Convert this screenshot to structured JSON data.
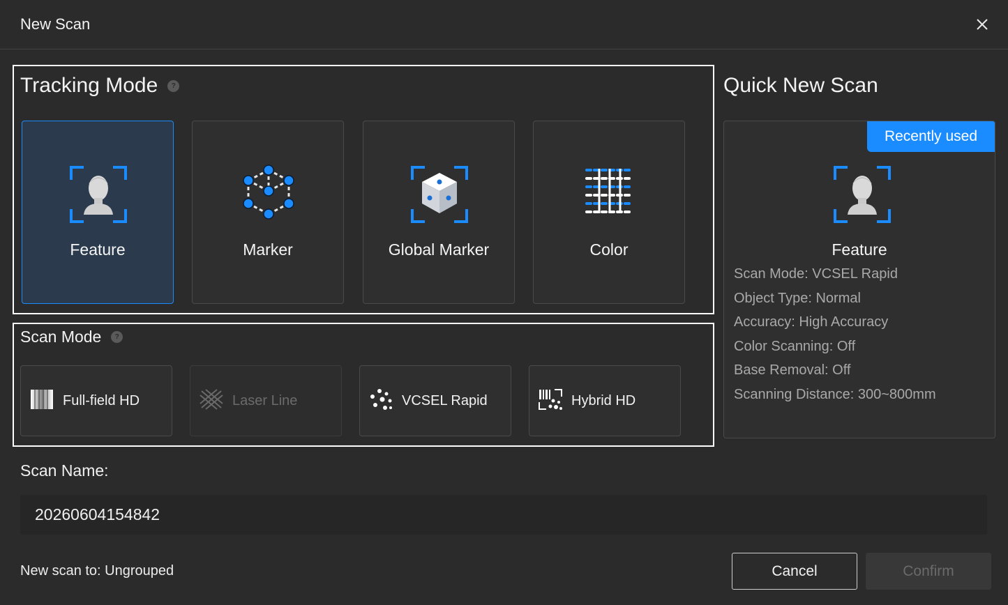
{
  "window": {
    "title": "New Scan"
  },
  "tracking": {
    "title": "Tracking Mode",
    "modes": [
      {
        "label": "Feature",
        "icon": "bust-icon",
        "selected": true
      },
      {
        "label": "Marker",
        "icon": "marker-network-icon",
        "selected": false
      },
      {
        "label": "Global Marker",
        "icon": "cube-icon",
        "selected": false
      },
      {
        "label": "Color",
        "icon": "color-grid-icon",
        "selected": false
      }
    ]
  },
  "scan_mode": {
    "title": "Scan Mode",
    "modes": [
      {
        "label": "Full-field HD",
        "icon": "fullfield-icon",
        "enabled": true
      },
      {
        "label": "Laser Line",
        "icon": "laser-cross-icon",
        "enabled": false
      },
      {
        "label": "VCSEL Rapid",
        "icon": "dots-icon",
        "enabled": true
      },
      {
        "label": "Hybrid HD",
        "icon": "hybrid-icon",
        "enabled": true
      }
    ]
  },
  "quick": {
    "title": "Quick New Scan",
    "badge": "Recently used",
    "mode": "Feature",
    "details": [
      "Scan Mode:  VCSEL Rapid",
      "Object Type:  Normal",
      "Accuracy:  High Accuracy",
      "Color Scanning:  Off",
      "Base Removal:  Off",
      "Scanning Distance:  300~800mm"
    ]
  },
  "scan_name": {
    "label": "Scan Name:",
    "value": "20260604154842"
  },
  "footer": {
    "new_scan_to": "New scan to: Ungrouped",
    "cancel": "Cancel",
    "confirm": "Confirm"
  },
  "colors": {
    "accent": "#1a8cff",
    "background": "#2b2b2b",
    "card": "#2f2f2f",
    "selected_card": "#2b3b4d"
  }
}
